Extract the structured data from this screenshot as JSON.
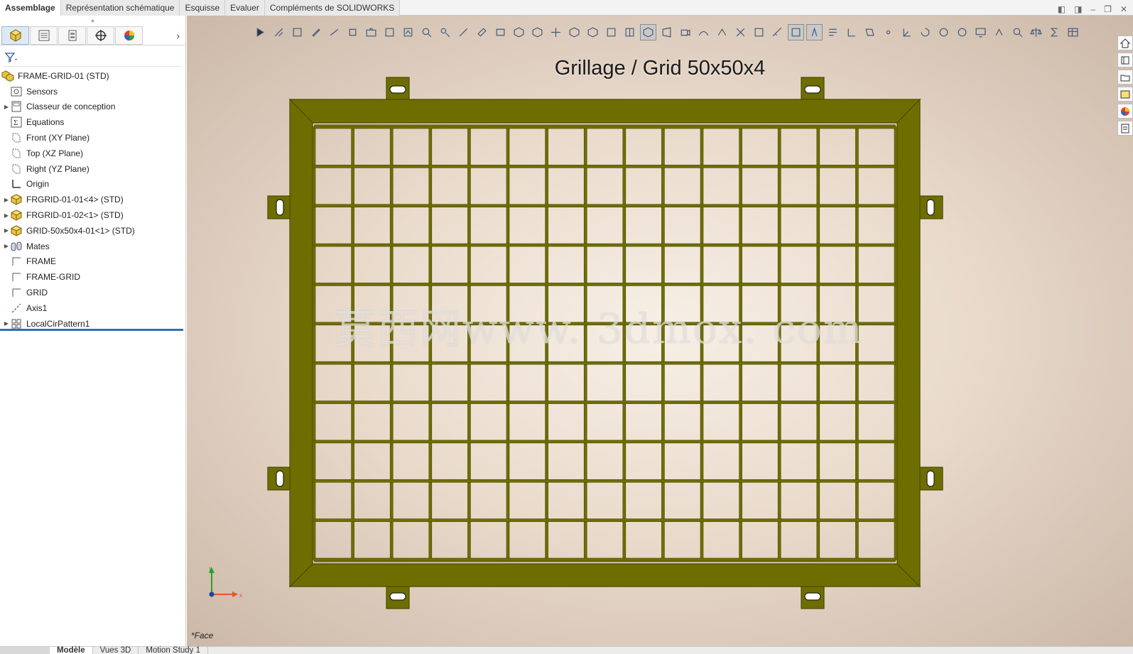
{
  "tabs": [
    {
      "label": "Assemblage",
      "active": true
    },
    {
      "label": "Représentation schématique",
      "active": false
    },
    {
      "label": "Esquisse",
      "active": false
    },
    {
      "label": "Evaluer",
      "active": false
    },
    {
      "label": "Compléments de SOLIDWORKS",
      "active": false
    }
  ],
  "feature_tree": {
    "root": "FRAME-GRID-01  (STD)",
    "items": [
      {
        "label": "Sensors",
        "icon": "sensors-icon",
        "expandable": false
      },
      {
        "label": "Classeur de conception",
        "icon": "design-binder-icon",
        "expandable": true
      },
      {
        "label": "Equations",
        "icon": "equations-icon",
        "expandable": false
      },
      {
        "label": "Front (XY Plane)",
        "icon": "plane-icon",
        "expandable": false
      },
      {
        "label": "Top (XZ Plane)",
        "icon": "plane-icon",
        "expandable": false
      },
      {
        "label": "Right (YZ Plane)",
        "icon": "plane-icon",
        "expandable": false
      },
      {
        "label": "Origin",
        "icon": "origin-icon",
        "expandable": false
      },
      {
        "label": "FRGRID-01-01<4> (STD)",
        "icon": "part-icon",
        "expandable": true
      },
      {
        "label": "FRGRID-01-02<1> (STD)",
        "icon": "part-icon",
        "expandable": true
      },
      {
        "label": "GRID-50x50x4-01<1> (STD)",
        "icon": "part-icon",
        "expandable": true
      },
      {
        "label": "Mates",
        "icon": "mates-icon",
        "expandable": true
      },
      {
        "label": "FRAME",
        "icon": "sketch-icon",
        "expandable": false
      },
      {
        "label": "FRAME-GRID",
        "icon": "sketch-icon",
        "expandable": false
      },
      {
        "label": "GRID",
        "icon": "sketch-icon",
        "expandable": false
      },
      {
        "label": "Axis1",
        "icon": "axis-icon",
        "expandable": false
      },
      {
        "label": "LocalCirPattern1",
        "icon": "pattern-icon",
        "expandable": true
      }
    ]
  },
  "viewport": {
    "title": "Grillage / Grid 50x50x4",
    "watermark": "莫西网www. 3dmox. com",
    "view_label": "*Face",
    "triad_x": "x",
    "triad_y": "y"
  },
  "bottom_tabs": [
    {
      "label": "Modèle",
      "active": true
    },
    {
      "label": "Vues 3D",
      "active": false
    },
    {
      "label": "Motion Study 1",
      "active": false
    }
  ],
  "colors": {
    "frame": "#6e6e00",
    "frame_dark": "#4a4a00",
    "accent": "#2f6fb8"
  }
}
